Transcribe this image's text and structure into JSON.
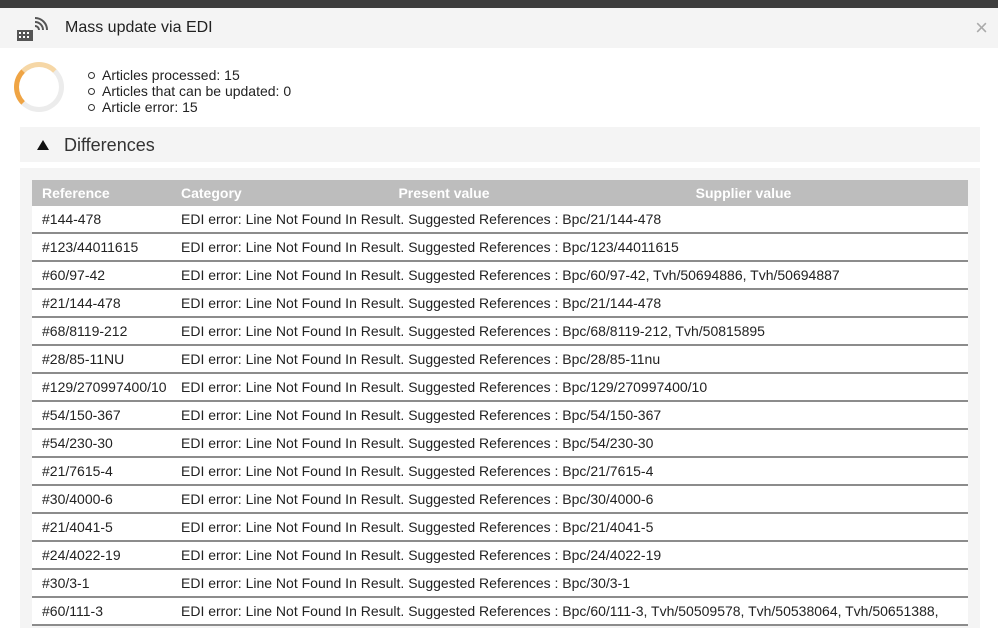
{
  "dialog": {
    "title": "Mass update via EDI",
    "close": "×"
  },
  "stats": [
    "Articles processed: 15",
    "Articles that can be updated: 0",
    "Article error: 15"
  ],
  "differences": {
    "label": "Differences",
    "columns": [
      "Reference",
      "Category",
      "Present value",
      "Supplier value"
    ],
    "rows": [
      {
        "ref": "#144-478",
        "msg": "EDI error: Line Not Found In Result. Suggested References : Bpc/21/144-478"
      },
      {
        "ref": "#123/44011615",
        "msg": "EDI error: Line Not Found In Result. Suggested References : Bpc/123/44011615"
      },
      {
        "ref": "#60/97-42",
        "msg": "EDI error: Line Not Found In Result. Suggested References : Bpc/60/97-42, Tvh/50694886, Tvh/50694887"
      },
      {
        "ref": "#21/144-478",
        "msg": "EDI error: Line Not Found In Result. Suggested References : Bpc/21/144-478"
      },
      {
        "ref": "#68/8119-212",
        "msg": "EDI error: Line Not Found In Result. Suggested References : Bpc/68/8119-212, Tvh/50815895"
      },
      {
        "ref": "#28/85-11NU",
        "msg": "EDI error: Line Not Found In Result. Suggested References : Bpc/28/85-11nu"
      },
      {
        "ref": "#129/270997400/10",
        "msg": "EDI error: Line Not Found In Result. Suggested References : Bpc/129/270997400/10"
      },
      {
        "ref": "#54/150-367",
        "msg": "EDI error: Line Not Found In Result. Suggested References : Bpc/54/150-367"
      },
      {
        "ref": "#54/230-30",
        "msg": "EDI error: Line Not Found In Result. Suggested References : Bpc/54/230-30"
      },
      {
        "ref": "#21/7615-4",
        "msg": "EDI error: Line Not Found In Result. Suggested References : Bpc/21/7615-4"
      },
      {
        "ref": "#30/4000-6",
        "msg": "EDI error: Line Not Found In Result. Suggested References : Bpc/30/4000-6"
      },
      {
        "ref": "#21/4041-5",
        "msg": "EDI error: Line Not Found In Result. Suggested References : Bpc/21/4041-5"
      },
      {
        "ref": "#24/4022-19",
        "msg": "EDI error: Line Not Found In Result. Suggested References : Bpc/24/4022-19"
      },
      {
        "ref": "#30/3-1",
        "msg": "EDI error: Line Not Found In Result. Suggested References : Bpc/30/3-1"
      },
      {
        "ref": "#60/111-3",
        "msg": "EDI error: Line Not Found In Result. Suggested References : Bpc/60/111-3, Tvh/50509578, Tvh/50538064, Tvh/50651388,"
      }
    ]
  },
  "icons": {
    "header": "edi-keyboard-signal-icon",
    "toggle": "triangle-up-icon",
    "progress": "spinner-icon"
  },
  "colors": {
    "spinner_accent": "#efa444",
    "table_header": "#bdbdbd"
  }
}
